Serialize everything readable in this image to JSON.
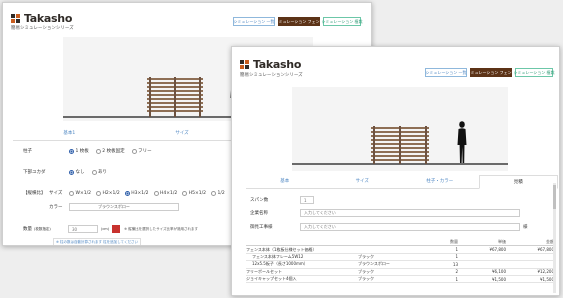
{
  "brand": {
    "name": "Takasho",
    "subtitle": "簡易シミュレーションシリーズ"
  },
  "header_buttons": {
    "estimate": "シミュレーション 一覧",
    "fence": "シミュレーション フェンス",
    "planting": "シミュレーション 植栽"
  },
  "back_window": {
    "tabs": [
      "基本1",
      "サイズ",
      "柱子・カラー"
    ],
    "fields": {
      "pillar_label": "柱子",
      "pillar_options": [
        "1 枚板",
        "2 枚板固定",
        "フリー"
      ],
      "lower_label": "下部ユカダ",
      "lower_options": [
        "なし",
        "あり"
      ],
      "ratio_label": "【縦横比】",
      "size_label": "サイズ",
      "size_options": [
        "W×1/2",
        "H2×1/2",
        "H3×1/2",
        "H4×1/2",
        "H5×1/2",
        "1/2"
      ],
      "color_label": "カラー",
      "color_value": "ブラウンスポロー",
      "count_label": "数量",
      "count_unit": "(枚数指定)",
      "count_value": "30",
      "count_suffix": "(cm)",
      "count_note": "※ 縦横比を選択したサイズ比率が適用されます",
      "bottom_note": "※ 柱の数は自動計算されます 柱を追加してください"
    }
  },
  "front_window": {
    "tabs": [
      "基本",
      "サイズ",
      "柱子・カラー",
      "見積"
    ],
    "span_label": "スパン数",
    "span_value": "1",
    "company_label": "企業名称",
    "company_placeholder": "入力してください",
    "contractor_label": "御見工事様",
    "contractor_placeholder": "入力してください",
    "contractor_suffix": "様",
    "table": {
      "headers": [
        "",
        "",
        "数量",
        "単価",
        "金額"
      ],
      "rows": [
        [
          "フェンス本体（1枚板仕様セット価格）",
          "",
          "1",
          "¥67,800",
          "¥67,800"
        ],
        [
          "フェンス本体フレーム5W12",
          "ブラック",
          "1",
          "",
          ""
        ],
        [
          "12x5.5板子（長さ1000mm）",
          "ブラウンスポロー",
          "13",
          "",
          ""
        ],
        [
          "フリーポールセット",
          "ブラック",
          "2",
          "¥6,100",
          "¥12,200"
        ],
        [
          "ジョイキャップセット4個入",
          "ブラック",
          "1",
          "¥1,500",
          "¥1,500"
        ]
      ]
    }
  },
  "colors": {
    "brown_button": "#5c3317",
    "green_accent": "#2e9c76",
    "blue_link": "#4d86c2",
    "fence_wood": "#8e6f55"
  }
}
